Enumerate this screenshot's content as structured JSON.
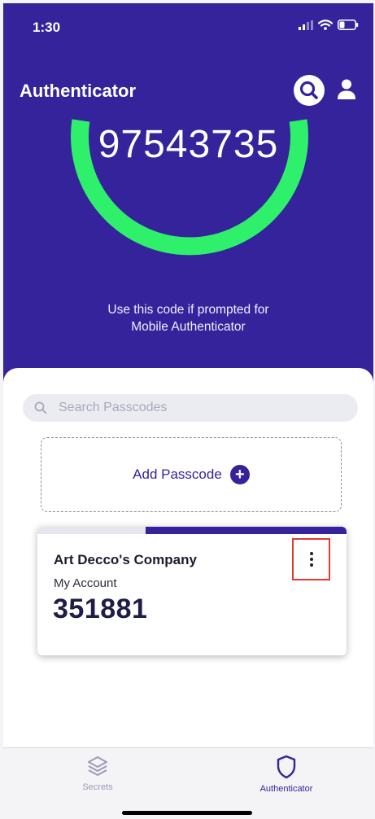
{
  "status_bar": {
    "time": "1:30"
  },
  "header": {
    "title": "Authenticator",
    "code": "97543735",
    "hint_line1": "Use this code if prompted for",
    "hint_line2": "Mobile Authenticator",
    "search_icon": "search-icon",
    "profile_icon": "person-icon",
    "accent_color": "#34239a",
    "timer_color": "#2ff06a"
  },
  "search": {
    "placeholder": "Search Passcodes"
  },
  "add_passcode": {
    "label": "Add Passcode"
  },
  "passcode_card": {
    "company": "Art Decco's Company",
    "account": "My Account",
    "code": "351881",
    "time_remaining_fraction": 0.65,
    "highlight_color": "#e33a30"
  },
  "nav": {
    "secrets_label": "Secrets",
    "authenticator_label": "Authenticator",
    "active": "Authenticator"
  }
}
